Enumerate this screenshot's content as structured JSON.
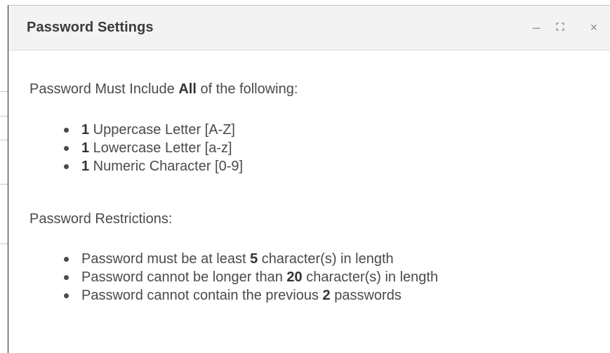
{
  "dialog": {
    "title": "Password Settings",
    "controls": {
      "minimize": "–",
      "maximize": "maximize-icon",
      "close": "×"
    }
  },
  "include_section": {
    "intro_prefix": "Password Must Include ",
    "intro_bold": "All",
    "intro_suffix": " of the following:",
    "items": [
      {
        "count": "1",
        "text": " Uppercase Letter [A-Z]"
      },
      {
        "count": "1",
        "text": " Lowercase Letter [a-z]"
      },
      {
        "count": "1",
        "text": " Numeric Character [0-9]"
      }
    ]
  },
  "restrictions_section": {
    "heading": "Password Restrictions:",
    "items": [
      {
        "prefix": "Password must be at least ",
        "value": "5",
        "suffix": " character(s) in length"
      },
      {
        "prefix": "Password cannot be longer than ",
        "value": "20",
        "suffix": " character(s) in length"
      },
      {
        "prefix": "Password cannot contain the previous ",
        "value": "2",
        "suffix": " passwords"
      }
    ]
  },
  "colors": {
    "titlebar_bg": "#f3f3f3",
    "text": "#4a4a4a",
    "title_text": "#3b3b3b",
    "control_icon": "#8a8a8a"
  }
}
